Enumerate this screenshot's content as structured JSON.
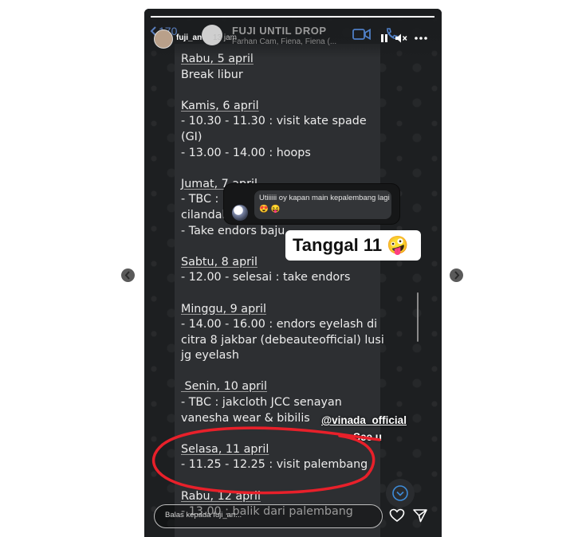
{
  "story": {
    "progress": 1.0,
    "username": "fuji_an",
    "time_ago": "13 jam",
    "reply_placeholder": "Balas kepada fuji_an...",
    "question": "Utiiiiii oy kapan main kepalembang lagi 😍 😝",
    "answer": "Tanggal 11 🤪",
    "mention": "@vinada_official",
    "caption": "See u"
  },
  "whatsapp": {
    "back_count": "170",
    "group_title": "FUJI UNTIL DROP",
    "group_members": "Farhan Cam, Fiena, Fiena (..."
  },
  "chat": {
    "lines": [
      {
        "text": "Rabu, 5 april",
        "day": true
      },
      {
        "text": "Break libur",
        "day": false
      },
      {
        "text": "",
        "day": false
      },
      {
        "text": "Kamis, 6 april",
        "day": true
      },
      {
        "text": "- 10.30 - 11.30 : visit kate spade",
        "day": false
      },
      {
        "text": "(GI)",
        "day": false
      },
      {
        "text": "- 13.00 - 14.00 : hoops",
        "day": false
      },
      {
        "text": "",
        "day": false
      },
      {
        "text": "Jumat, 7 april",
        "day": true
      },
      {
        "text": "- TBC : l",
        "day": false
      },
      {
        "text": "cilandak",
        "day": false
      },
      {
        "text": "- Take endors baju",
        "day": false
      },
      {
        "text": "",
        "day": false
      },
      {
        "text": "Sabtu, 8 april",
        "day": true
      },
      {
        "text": "- 12.00 - selesai : take endors",
        "day": false
      },
      {
        "text": "",
        "day": false
      },
      {
        "text": "Minggu, 9 april",
        "day": true
      },
      {
        "text": "- 14.00 - 16.00 : endors eyelash di",
        "day": false
      },
      {
        "text": "citra 8 jakbar (debeauteofficial) lusi",
        "day": false
      },
      {
        "text": "jg eyelash",
        "day": false
      },
      {
        "text": "",
        "day": false
      },
      {
        "text": " Senin, 10 april",
        "day": true
      },
      {
        "text": "- TBC : jakcloth JCC senayan",
        "day": false
      },
      {
        "text": "vanesha wear & bibilis",
        "day": false
      },
      {
        "text": "",
        "day": false
      },
      {
        "text": "Selasa, 11 april",
        "day": true
      },
      {
        "text": "- 11.25 - 12.25 : visit palembang",
        "day": false
      },
      {
        "text": "",
        "day": false
      },
      {
        "text": "Rabu, 12 april",
        "day": true
      },
      {
        "text": "- 13.00 : balik dari palembang",
        "day": false
      }
    ]
  },
  "colors": {
    "annotation_circle": "#e8202a",
    "chat_panel": "#2d2f32",
    "story_background": "#1b1d1f",
    "whatsapp_back": "#5a7fbf"
  },
  "icons": {
    "header": [
      "back-arrow-icon",
      "video-call-icon",
      "phone-call-icon",
      "pause-icon",
      "mute-icon",
      "more-options-icon"
    ],
    "footer": [
      "heart-icon",
      "send-icon"
    ],
    "chat": [
      "scroll-down-icon"
    ],
    "navigation": [
      "previous-story-icon",
      "next-story-icon"
    ]
  }
}
